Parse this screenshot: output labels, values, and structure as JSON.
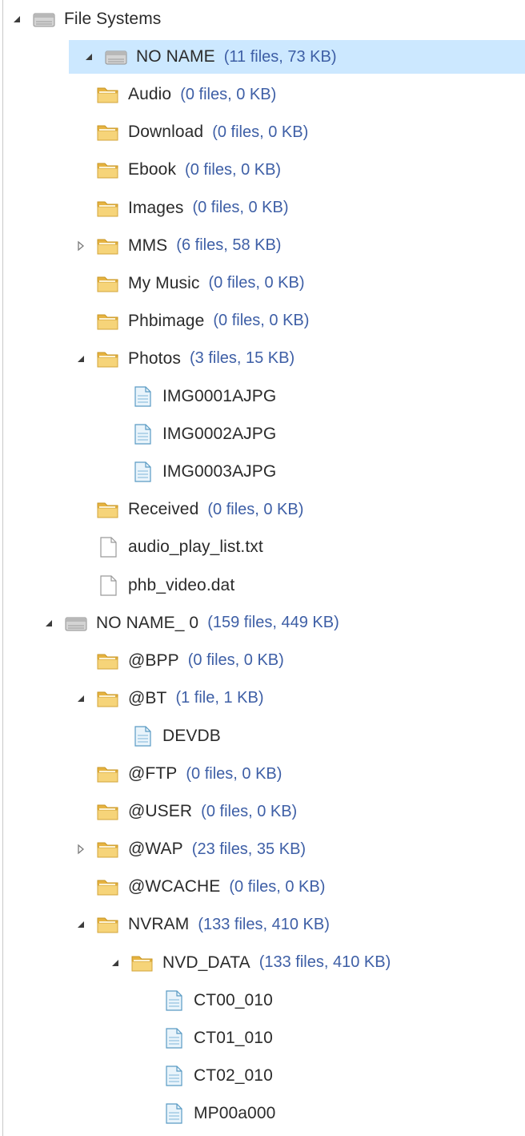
{
  "tree": [
    {
      "label": "File Systems",
      "info": "",
      "depth": 0,
      "type": "root",
      "toggle": "expanded",
      "selected": false
    },
    {
      "label": "NO NAME",
      "info": "(11 files, 73 KB)",
      "depth": 1,
      "type": "drive",
      "toggle": "expanded",
      "selected": true
    },
    {
      "label": "Audio",
      "info": "(0 files, 0 KB)",
      "depth": 2,
      "type": "folder",
      "toggle": "none",
      "selected": false
    },
    {
      "label": "Download",
      "info": "(0 files, 0 KB)",
      "depth": 2,
      "type": "folder",
      "toggle": "none",
      "selected": false
    },
    {
      "label": "Ebook",
      "info": "(0 files, 0 KB)",
      "depth": 2,
      "type": "folder",
      "toggle": "none",
      "selected": false
    },
    {
      "label": "Images",
      "info": "(0 files, 0 KB)",
      "depth": 2,
      "type": "folder",
      "toggle": "none",
      "selected": false
    },
    {
      "label": "MMS",
      "info": "(6 files, 58 KB)",
      "depth": 2,
      "type": "folder",
      "toggle": "collapsed",
      "selected": false
    },
    {
      "label": "My Music",
      "info": "(0 files, 0 KB)",
      "depth": 2,
      "type": "folder",
      "toggle": "none",
      "selected": false
    },
    {
      "label": "Phbimage",
      "info": "(0 files, 0 KB)",
      "depth": 2,
      "type": "folder",
      "toggle": "none",
      "selected": false
    },
    {
      "label": "Photos",
      "info": "(3 files, 15 KB)",
      "depth": 2,
      "type": "folder",
      "toggle": "expanded",
      "selected": false
    },
    {
      "label": "IMG0001AJPG",
      "info": "",
      "depth": 3,
      "type": "file-blue",
      "toggle": "none",
      "selected": false
    },
    {
      "label": "IMG0002AJPG",
      "info": "",
      "depth": 3,
      "type": "file-blue",
      "toggle": "none",
      "selected": false
    },
    {
      "label": "IMG0003AJPG",
      "info": "",
      "depth": 3,
      "type": "file-blue",
      "toggle": "none",
      "selected": false
    },
    {
      "label": "Received",
      "info": "(0 files, 0 KB)",
      "depth": 2,
      "type": "folder",
      "toggle": "none",
      "selected": false
    },
    {
      "label": "audio_play_list.txt",
      "info": "",
      "depth": 2,
      "type": "file-plain",
      "toggle": "none",
      "selected": false
    },
    {
      "label": "phb_video.dat",
      "info": "",
      "depth": 2,
      "type": "file-plain",
      "toggle": "none",
      "selected": false
    },
    {
      "label": "NO NAME_ 0",
      "info": "(159 files, 449 KB)",
      "depth": 1,
      "type": "drive",
      "toggle": "expanded",
      "selected": false
    },
    {
      "label": "@BPP",
      "info": "(0 files, 0 KB)",
      "depth": 2,
      "type": "folder",
      "toggle": "none",
      "selected": false
    },
    {
      "label": "@BT",
      "info": "(1 file, 1 KB)",
      "depth": 2,
      "type": "folder",
      "toggle": "expanded",
      "selected": false
    },
    {
      "label": "DEVDB",
      "info": "",
      "depth": 3,
      "type": "file-blue",
      "toggle": "none",
      "selected": false
    },
    {
      "label": "@FTP",
      "info": "(0 files, 0 KB)",
      "depth": 2,
      "type": "folder",
      "toggle": "none",
      "selected": false
    },
    {
      "label": "@USER",
      "info": "(0 files, 0 KB)",
      "depth": 2,
      "type": "folder",
      "toggle": "none",
      "selected": false
    },
    {
      "label": "@WAP",
      "info": "(23 files, 35 KB)",
      "depth": 2,
      "type": "folder",
      "toggle": "collapsed",
      "selected": false
    },
    {
      "label": "@WCACHE",
      "info": "(0 files, 0 KB)",
      "depth": 2,
      "type": "folder",
      "toggle": "none",
      "selected": false
    },
    {
      "label": "NVRAM",
      "info": "(133 files, 410 KB)",
      "depth": 2,
      "type": "folder",
      "toggle": "expanded",
      "selected": false
    },
    {
      "label": "NVD_DATA",
      "info": "(133 files, 410 KB)",
      "depth": 3,
      "type": "folder",
      "toggle": "expanded",
      "selected": false
    },
    {
      "label": "CT00_010",
      "info": "",
      "depth": 4,
      "type": "file-blue",
      "toggle": "none",
      "selected": false
    },
    {
      "label": "CT01_010",
      "info": "",
      "depth": 4,
      "type": "file-blue",
      "toggle": "none",
      "selected": false
    },
    {
      "label": "CT02_010",
      "info": "",
      "depth": 4,
      "type": "file-blue",
      "toggle": "none",
      "selected": false
    },
    {
      "label": "MP00a000",
      "info": "",
      "depth": 4,
      "type": "file-blue",
      "toggle": "none",
      "selected": false
    }
  ],
  "icons": {
    "root": "drive-icon",
    "drive": "drive-icon",
    "folder": "folder-icon",
    "file-blue": "document-icon",
    "file-plain": "text-file-icon"
  },
  "colors": {
    "selection": "#cce8ff",
    "info_text": "#3e5fa6",
    "label_text": "#2b2b2b",
    "folder": "#f2c560",
    "drive": "#a9a9a9"
  }
}
